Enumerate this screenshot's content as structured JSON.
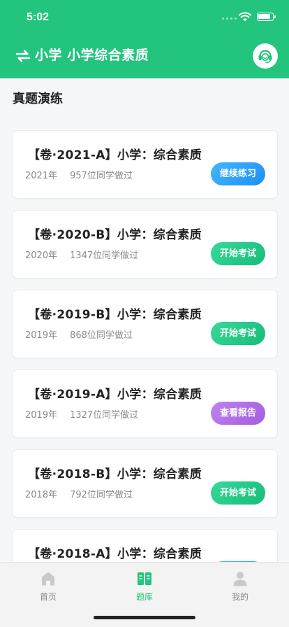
{
  "status_bar": {
    "time": "5:02"
  },
  "header": {
    "title": "小学 小学综合素质",
    "swap_icon": "swap-icon",
    "support_icon": "headset-support-icon"
  },
  "section": {
    "title": "真题演练"
  },
  "papers": [
    {
      "title": "【卷·2021-A】小学：综合素质",
      "year": "2021年",
      "count": "957位同学做过",
      "action": "继续练习",
      "style": "blue"
    },
    {
      "title": "【卷·2020-B】小学：综合素质",
      "year": "2020年",
      "count": "1347位同学做过",
      "action": "开始考试",
      "style": "green"
    },
    {
      "title": "【卷·2019-B】小学：综合素质",
      "year": "2019年",
      "count": "868位同学做过",
      "action": "开始考试",
      "style": "green"
    },
    {
      "title": "【卷·2019-A】小学：综合素质",
      "year": "2019年",
      "count": "1327位同学做过",
      "action": "查看报告",
      "style": "purple"
    },
    {
      "title": "【卷·2018-B】小学：综合素质",
      "year": "2018年",
      "count": "792位同学做过",
      "action": "开始考试",
      "style": "green"
    },
    {
      "title": "【卷·2018-A】小学：综合素质",
      "year": "",
      "count": "",
      "action": "",
      "style": "green"
    }
  ],
  "tabbar": {
    "items": [
      {
        "label": "首页",
        "icon": "home-icon",
        "active": false
      },
      {
        "label": "题库",
        "icon": "question-bank-icon",
        "active": true
      },
      {
        "label": "我的",
        "icon": "profile-icon",
        "active": false
      }
    ]
  },
  "colors": {
    "brand": "#22c47e",
    "blue_button": "#2c9bf7",
    "green_button": "#1fc585",
    "purple_button": "#ad6be6"
  }
}
